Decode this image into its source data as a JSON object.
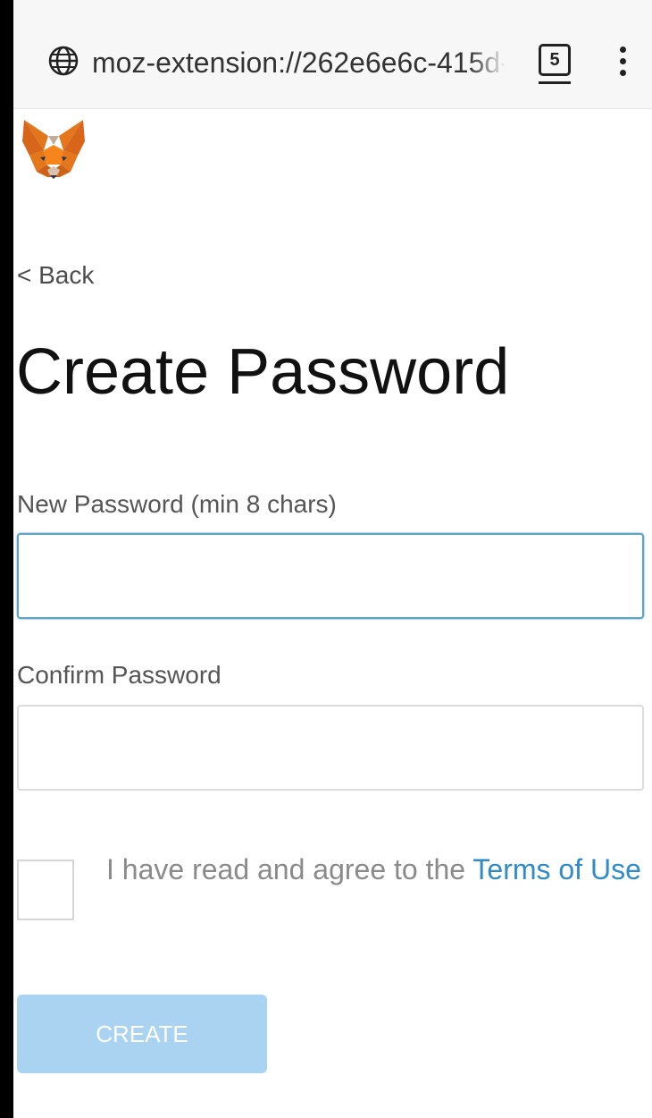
{
  "browser": {
    "url": "moz-extension://262e6e6c-415d-",
    "tab_count": "5",
    "globe_icon": "globe-icon",
    "menu_icon": "vertical-ellipsis-icon"
  },
  "app": {
    "logo_icon": "metamask-fox-icon"
  },
  "nav": {
    "back_label": "< Back"
  },
  "form": {
    "title": "Create Password",
    "new_password": {
      "label": "New Password (min 8 chars)",
      "value": ""
    },
    "confirm_password": {
      "label": "Confirm Password",
      "value": ""
    },
    "terms": {
      "checked": false,
      "text": "I have read and agree to the ",
      "link_label": "Terms of Use"
    },
    "create_label": "CREATE"
  },
  "colors": {
    "accent": "#2f8bc9",
    "button_disabled": "#a9d3f0",
    "input_focus": "#5ea2c6"
  }
}
